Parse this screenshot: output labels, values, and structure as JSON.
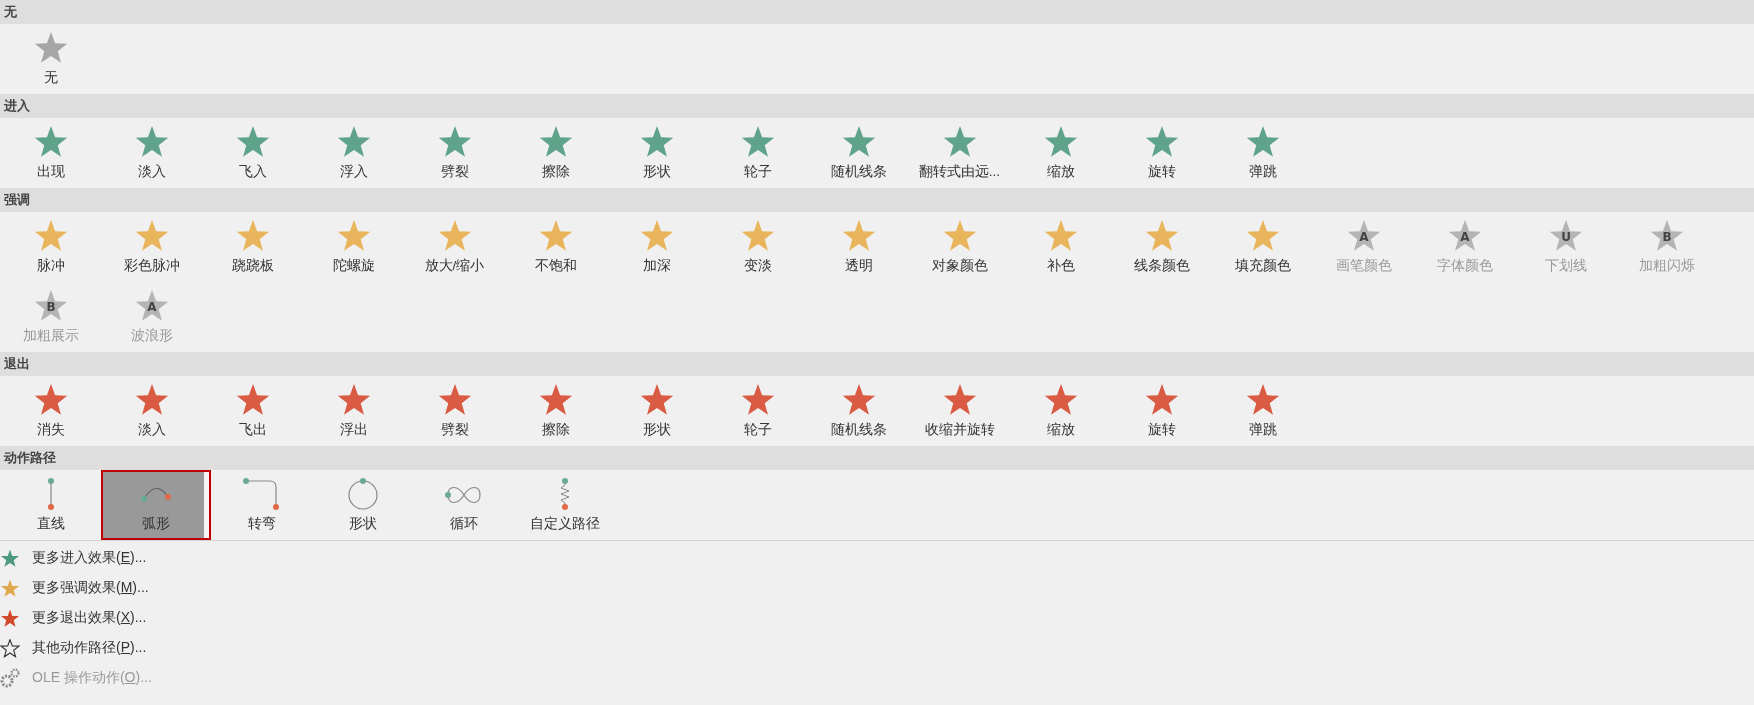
{
  "sections": [
    {
      "title": "无",
      "kind": "none",
      "items": [
        {
          "label": "无",
          "disabled": false
        }
      ]
    },
    {
      "title": "进入",
      "kind": "entrance",
      "items": [
        {
          "label": "出现",
          "disabled": false
        },
        {
          "label": "淡入",
          "disabled": false
        },
        {
          "label": "飞入",
          "disabled": false
        },
        {
          "label": "浮入",
          "disabled": false
        },
        {
          "label": "劈裂",
          "disabled": false
        },
        {
          "label": "擦除",
          "disabled": false
        },
        {
          "label": "形状",
          "disabled": false
        },
        {
          "label": "轮子",
          "disabled": false
        },
        {
          "label": "随机线条",
          "disabled": false
        },
        {
          "label": "翻转式由远...",
          "disabled": false
        },
        {
          "label": "缩放",
          "disabled": false
        },
        {
          "label": "旋转",
          "disabled": false
        },
        {
          "label": "弹跳",
          "disabled": false
        }
      ]
    },
    {
      "title": "强调",
      "kind": "emphasis",
      "items": [
        {
          "label": "脉冲",
          "disabled": false
        },
        {
          "label": "彩色脉冲",
          "disabled": false
        },
        {
          "label": "跷跷板",
          "disabled": false
        },
        {
          "label": "陀螺旋",
          "disabled": false
        },
        {
          "label": "放大/缩小",
          "disabled": false
        },
        {
          "label": "不饱和",
          "disabled": false
        },
        {
          "label": "加深",
          "disabled": false
        },
        {
          "label": "变淡",
          "disabled": false
        },
        {
          "label": "透明",
          "disabled": false
        },
        {
          "label": "对象颜色",
          "disabled": false
        },
        {
          "label": "补色",
          "disabled": false
        },
        {
          "label": "线条颜色",
          "disabled": false
        },
        {
          "label": "填充颜色",
          "disabled": false
        },
        {
          "label": "画笔颜色",
          "disabled": true,
          "glyph": "A"
        },
        {
          "label": "字体颜色",
          "disabled": true,
          "glyph": "A"
        },
        {
          "label": "下划线",
          "disabled": true,
          "glyph": "U"
        },
        {
          "label": "加粗闪烁",
          "disabled": true,
          "glyph": "B"
        },
        {
          "label": "加粗展示",
          "disabled": true,
          "glyph": "B"
        },
        {
          "label": "波浪形",
          "disabled": true,
          "glyph": "A"
        }
      ]
    },
    {
      "title": "退出",
      "kind": "exit",
      "items": [
        {
          "label": "消失",
          "disabled": false
        },
        {
          "label": "淡入",
          "disabled": false
        },
        {
          "label": "飞出",
          "disabled": false
        },
        {
          "label": "浮出",
          "disabled": false
        },
        {
          "label": "劈裂",
          "disabled": false
        },
        {
          "label": "擦除",
          "disabled": false
        },
        {
          "label": "形状",
          "disabled": false
        },
        {
          "label": "轮子",
          "disabled": false
        },
        {
          "label": "随机线条",
          "disabled": false
        },
        {
          "label": "收缩并旋转",
          "disabled": false
        },
        {
          "label": "缩放",
          "disabled": false
        },
        {
          "label": "旋转",
          "disabled": false
        },
        {
          "label": "弹跳",
          "disabled": false
        }
      ]
    },
    {
      "title": "动作路径",
      "kind": "motion",
      "paths": [
        {
          "label": "直线",
          "kind": "line",
          "selected": false
        },
        {
          "label": "弧形",
          "kind": "arc",
          "selected": true
        },
        {
          "label": "转弯",
          "kind": "turn",
          "selected": false
        },
        {
          "label": "形状",
          "kind": "shape",
          "selected": false
        },
        {
          "label": "循环",
          "kind": "loop",
          "selected": false
        },
        {
          "label": "自定义路径",
          "kind": "custom",
          "selected": false
        }
      ]
    }
  ],
  "menu": [
    {
      "kind": "star",
      "color": "#4f9a7f",
      "text": "更多进入效果(",
      "key": "E",
      "tail": ")...",
      "disabled": false
    },
    {
      "kind": "star",
      "color": "#e0a84e",
      "text": "更多强调效果(",
      "key": "M",
      "tail": ")...",
      "disabled": false
    },
    {
      "kind": "star",
      "color": "#d24a2e",
      "text": "更多退出效果(",
      "key": "X",
      "tail": ")...",
      "disabled": false
    },
    {
      "kind": "outline-star",
      "text": "其他动作路径(",
      "key": "P",
      "tail": ")...",
      "disabled": false
    },
    {
      "kind": "gears",
      "text": "OLE 操作动作(",
      "key": "O",
      "tail": ")...",
      "disabled": true
    }
  ]
}
